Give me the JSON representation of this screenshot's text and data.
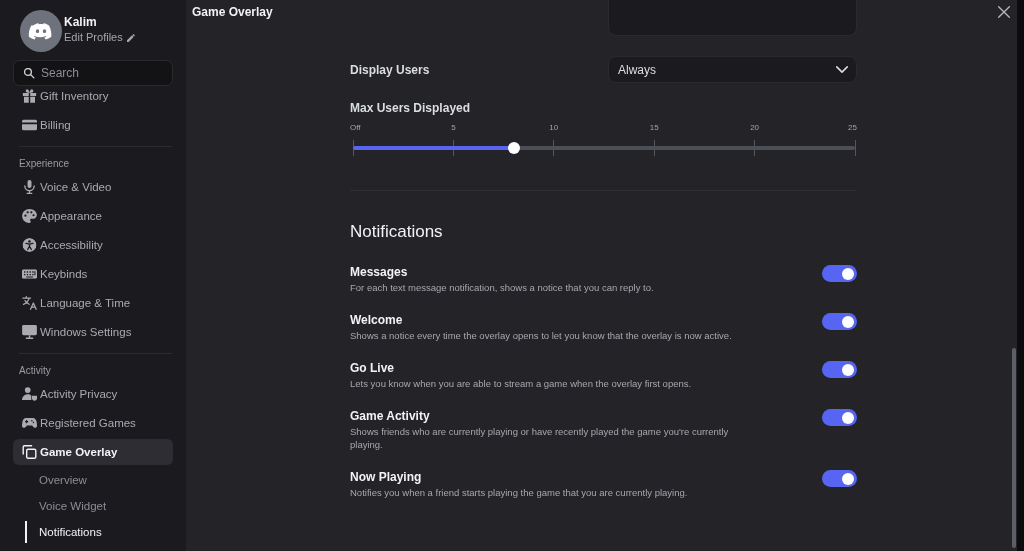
{
  "sidebar": {
    "profile": {
      "name": "Kalim",
      "subtitle": "Edit Profiles"
    },
    "search": {
      "placeholder": "Search"
    },
    "sections": [
      {
        "items": [
          {
            "label": "Gift Inventory",
            "selected": false
          },
          {
            "label": "Billing",
            "selected": false
          }
        ]
      },
      {
        "title": "Experience",
        "items": [
          {
            "label": "Voice & Video",
            "selected": false
          },
          {
            "label": "Appearance",
            "selected": false
          },
          {
            "label": "Accessibility",
            "selected": false
          },
          {
            "label": "Keybinds",
            "selected": false
          },
          {
            "label": "Language & Time",
            "selected": false
          },
          {
            "label": "Windows Settings",
            "selected": false
          }
        ]
      },
      {
        "title": "Activity",
        "items": [
          {
            "label": "Activity Privacy",
            "selected": false
          },
          {
            "label": "Registered Games",
            "selected": false
          },
          {
            "label": "Game Overlay",
            "selected": true,
            "children": [
              {
                "label": "Overview",
                "selected": false
              },
              {
                "label": "Voice Widget",
                "selected": false
              },
              {
                "label": "Notifications",
                "selected": true
              }
            ]
          }
        ]
      }
    ]
  },
  "header": {
    "title": "Game Overlay"
  },
  "overlay_settings": {
    "display_users": {
      "label": "Display Users",
      "value": "Always"
    },
    "max_users": {
      "label": "Max Users Displayed",
      "ticks": [
        "Off",
        "5",
        "10",
        "15",
        "20",
        "25"
      ],
      "level": 0.32
    }
  },
  "notifications": {
    "title": "Notifications",
    "items": [
      {
        "title": "Messages",
        "description": "For each text message notification, shows a notice that you can reply to.",
        "on": true
      },
      {
        "title": "Welcome",
        "description": "Shows a notice every time the overlay opens to let you know that the overlay is now active.",
        "on": true
      },
      {
        "title": "Go Live",
        "description": "Lets you know when you are able to stream a game when the overlay first opens.",
        "on": true
      },
      {
        "title": "Game Activity",
        "description": "Shows friends who are currently playing or have recently played the game you're currently playing.",
        "on": true
      },
      {
        "title": "Now Playing",
        "description": "Notifies you when a friend starts playing the game that you are currently playing.",
        "on": true
      }
    ]
  }
}
